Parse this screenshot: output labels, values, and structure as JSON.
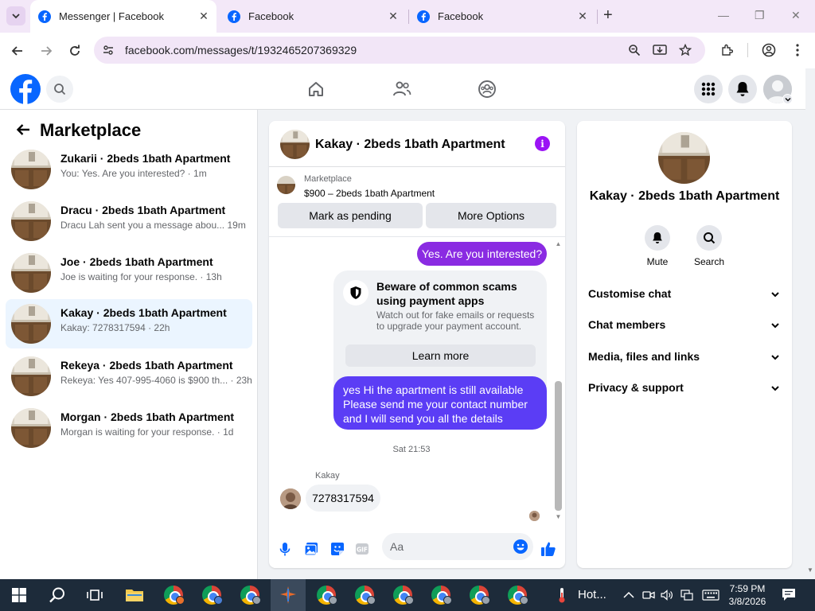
{
  "browser": {
    "tabs": [
      {
        "title": "Messenger | Facebook",
        "active": true
      },
      {
        "title": "Facebook",
        "active": false
      },
      {
        "title": "Facebook",
        "active": false
      }
    ],
    "tab_close": "✕",
    "new_tab": "+",
    "url": "facebook.com/messages/t/1932465207369329",
    "window_controls": {
      "minimize": "—",
      "maximize": "❐",
      "close": "✕"
    }
  },
  "left_panel": {
    "title": "Marketplace",
    "conversations": [
      {
        "title": "Zukarii · 2beds 1bath Apartment",
        "preview": "You: Yes. Are you interested? · ",
        "time": "1m",
        "selected": false
      },
      {
        "title": "Dracu · 2beds 1bath Apartment",
        "preview": "Dracu Lah sent you a message abou... ",
        "time": "19m",
        "selected": false
      },
      {
        "title": "Joe · 2beds 1bath Apartment",
        "preview": "Joe is waiting for your response. · ",
        "time": "13h",
        "selected": false
      },
      {
        "title": "Kakay · 2beds 1bath Apartment",
        "preview": "Kakay: 7278317594 · ",
        "time": "22h",
        "selected": true
      },
      {
        "title": "Rekeya · 2beds 1bath Apartment",
        "preview": "Rekeya: Yes 407-995-4060 is $900 th... · ",
        "time": "23h",
        "selected": false
      },
      {
        "title": "Morgan · 2beds 1bath Apartment",
        "preview": "Morgan is waiting for your response. · ",
        "time": "1d",
        "selected": false
      }
    ]
  },
  "chat": {
    "title": "Kakay · 2beds 1bath Apartment",
    "info_glyph": "i",
    "listing": {
      "category": "Marketplace",
      "price_title": "$900 – 2beds 1bath Apartment"
    },
    "buttons": {
      "mark_pending": "Mark as pending",
      "more_options": "More Options"
    },
    "messages": {
      "out_1": "Yes. Are you interested?",
      "scam_title": "Beware of common scams using payment apps",
      "scam_text": "Watch out for fake emails or requests to upgrade your payment account.",
      "learn_more": "Learn more",
      "out_2": "yes Hi the apartment is still available Please send me your contact number and I will send you all the details",
      "timestamp": "Sat 21:53",
      "sender": "Kakay",
      "in_1": "7278317594"
    },
    "composer_placeholder": "Aa"
  },
  "right_panel": {
    "name": "Kakay · 2beds 1bath Apartment",
    "actions": {
      "mute": "Mute",
      "search": "Search"
    },
    "sections": [
      "Customise chat",
      "Chat members",
      "Media, files and links",
      "Privacy & support"
    ]
  },
  "taskbar": {
    "weather": "Hot...",
    "time": "7:59 PM",
    "date": "3/8/2026"
  },
  "colors": {
    "accent_purple": "#8a2be2",
    "accent_blue": "#5b3df5",
    "facebook_blue": "#0866ff",
    "selected_row": "#ebf5ff",
    "taskbar": "#1d2b3a"
  }
}
